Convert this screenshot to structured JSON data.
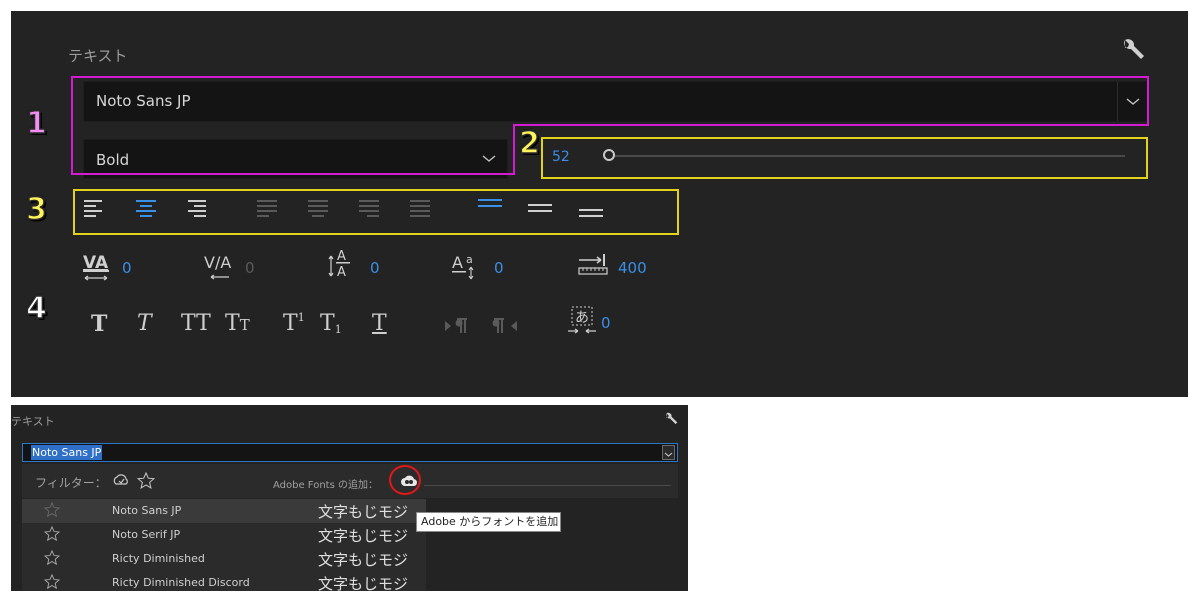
{
  "panel": {
    "title": "テキスト",
    "font": "Noto Sans JP",
    "style": "Bold",
    "size": "52",
    "size_level": 0.0,
    "metrics": {
      "kerning": "0",
      "tracking": "0",
      "leading": "0",
      "baseline_shift": "0",
      "tab_width": "400",
      "tsume": "0"
    }
  },
  "badges": [
    "1",
    "2",
    "3",
    "4"
  ],
  "dropdown": {
    "title": "テキスト",
    "value": "Noto Sans JP",
    "filter_label": "フィルター：",
    "adobe_fonts_label": "Adobe Fonts の追加：",
    "tooltip": "Adobe からフォントを追加",
    "fonts": [
      {
        "name": "Noto Sans JP",
        "sample": "文字もじモジ",
        "selected": true
      },
      {
        "name": "Noto Serif JP",
        "sample": "文字もじモジ",
        "selected": false
      },
      {
        "name": "Ricty Diminished",
        "sample": "文字もじモジ",
        "selected": false
      },
      {
        "name": "Ricty Diminished Discord",
        "sample": "文字もじモジ",
        "selected": false
      }
    ]
  },
  "colors": {
    "accent": "#3a8fe6",
    "highlight_magenta": "#d21bd2",
    "highlight_yellow": "#e2d21b",
    "annotation_circle": "#e01818"
  },
  "icons": {
    "wrench": "wrench-icon",
    "chevron": "chevron-down-icon",
    "star": "star-outline-icon",
    "creative_cloud": "creative-cloud-icon"
  }
}
